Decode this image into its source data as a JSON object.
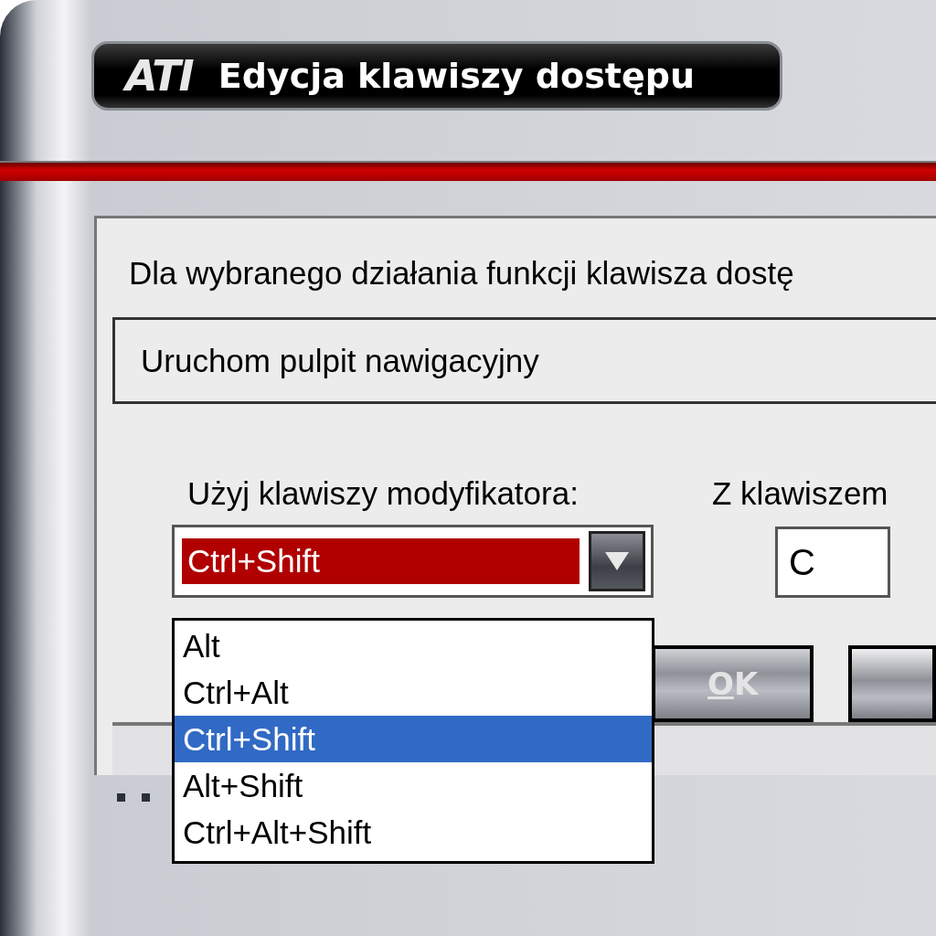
{
  "window": {
    "logo": "ATI",
    "title": "Edycja klawiszy dostępu"
  },
  "instruction": "Dla wybranego działania funkcji klawisza dostę",
  "action_field": {
    "value": "Uruchom pulpit nawigacyjny"
  },
  "modifier": {
    "label": "Użyj klawiszy modyfikatora:",
    "value": "Ctrl+Shift",
    "expanded": true,
    "options": [
      {
        "label": "Alt",
        "selected": false
      },
      {
        "label": "Ctrl+Alt",
        "selected": false
      },
      {
        "label": "Ctrl+Shift",
        "selected": true
      },
      {
        "label": "Alt+Shift",
        "selected": false
      },
      {
        "label": "Ctrl+Alt+Shift",
        "selected": false
      }
    ]
  },
  "key": {
    "label": "Z klawiszem",
    "value": "C"
  },
  "buttons": [
    "OK"
  ]
}
